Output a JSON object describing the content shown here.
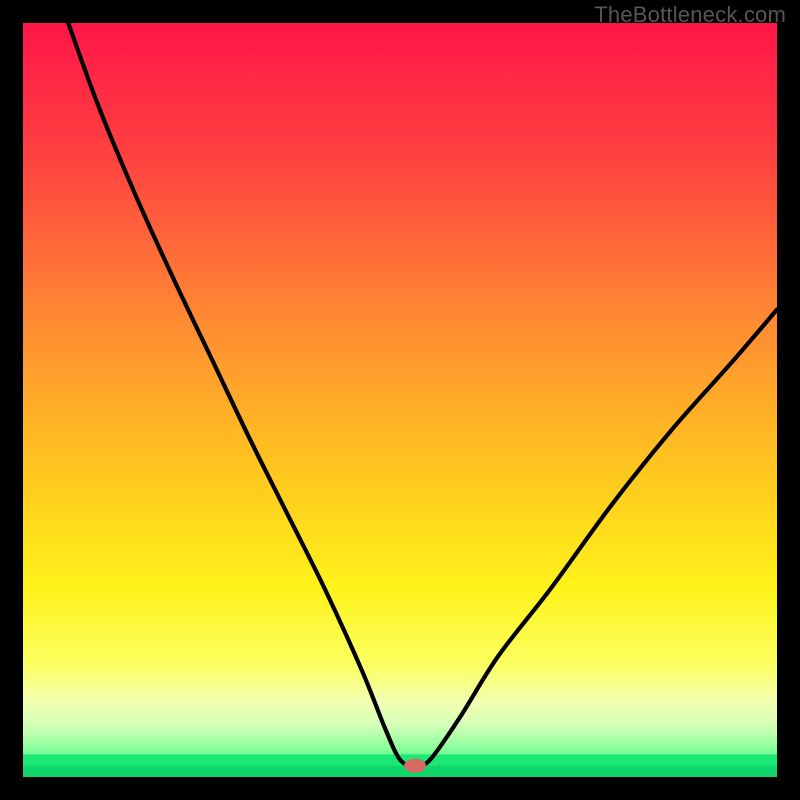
{
  "watermark": "TheBottleneck.com",
  "chart_data": {
    "type": "line",
    "title": "",
    "xlabel": "",
    "ylabel": "",
    "xlim": [
      0,
      100
    ],
    "ylim": [
      0,
      100
    ],
    "grid": false,
    "legend": false,
    "description": "V-shaped bottleneck curve over a vertical spectral gradient (red → orange → yellow → green) with a thin green band at the bottom. Minimum marked by a red oval near x ≈ 52.",
    "series": [
      {
        "name": "bottleneck-curve",
        "x": [
          6,
          10,
          15,
          20,
          25,
          30,
          35,
          40,
          45,
          48,
          50,
          52,
          54,
          58,
          63,
          70,
          78,
          86,
          94,
          100
        ],
        "values": [
          100,
          89,
          77,
          66,
          55.5,
          45,
          35,
          25,
          14,
          6.5,
          2.3,
          1.5,
          2.3,
          8,
          16,
          25,
          36,
          46,
          55,
          62
        ]
      }
    ],
    "marker": {
      "x": 52,
      "y": 1.5,
      "color": "#d86a64"
    },
    "gradient_stops": [
      {
        "offset": 0,
        "color": "#ff1649"
      },
      {
        "offset": 18,
        "color": "#ff4240"
      },
      {
        "offset": 40,
        "color": "#ff8c32"
      },
      {
        "offset": 60,
        "color": "#ffc81e"
      },
      {
        "offset": 75,
        "color": "#fff31b"
      },
      {
        "offset": 85,
        "color": "#fcff60"
      },
      {
        "offset": 90,
        "color": "#f2ffb0"
      },
      {
        "offset": 93,
        "color": "#d6ffb8"
      },
      {
        "offset": 96,
        "color": "#8fff9e"
      },
      {
        "offset": 100,
        "color": "#1de876"
      }
    ],
    "green_band": {
      "from_y": 0,
      "to_y": 3
    }
  }
}
